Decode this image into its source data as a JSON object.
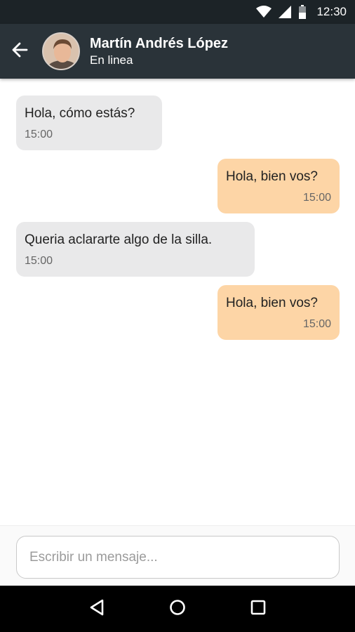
{
  "status_bar": {
    "time": "12:30",
    "icons": [
      "wifi-icon",
      "signal-icon",
      "battery-icon"
    ]
  },
  "header": {
    "back_icon": "arrow-left-icon",
    "contact_name": "Martín Andrés López",
    "contact_status": "En linea"
  },
  "messages": [
    {
      "direction": "in",
      "text": "Hola, cómo estás?",
      "time": "15:00"
    },
    {
      "direction": "out",
      "text": "Hola, bien vos?",
      "time": "15:00"
    },
    {
      "direction": "in",
      "text": "Queria aclararte algo de la silla.",
      "time": "15:00"
    },
    {
      "direction": "out",
      "text": "Hola, bien vos?",
      "time": "15:00"
    }
  ],
  "composer": {
    "placeholder": "Escribir un mensaje..."
  },
  "nav_bar": {
    "icons": [
      "back-triangle-icon",
      "home-circle-icon",
      "recents-square-icon"
    ]
  },
  "colors": {
    "status_bar": "#1c2327",
    "app_bar": "#2a3339",
    "incoming_bubble": "#e9e9ea",
    "outgoing_bubble": "#fdd5a6"
  }
}
